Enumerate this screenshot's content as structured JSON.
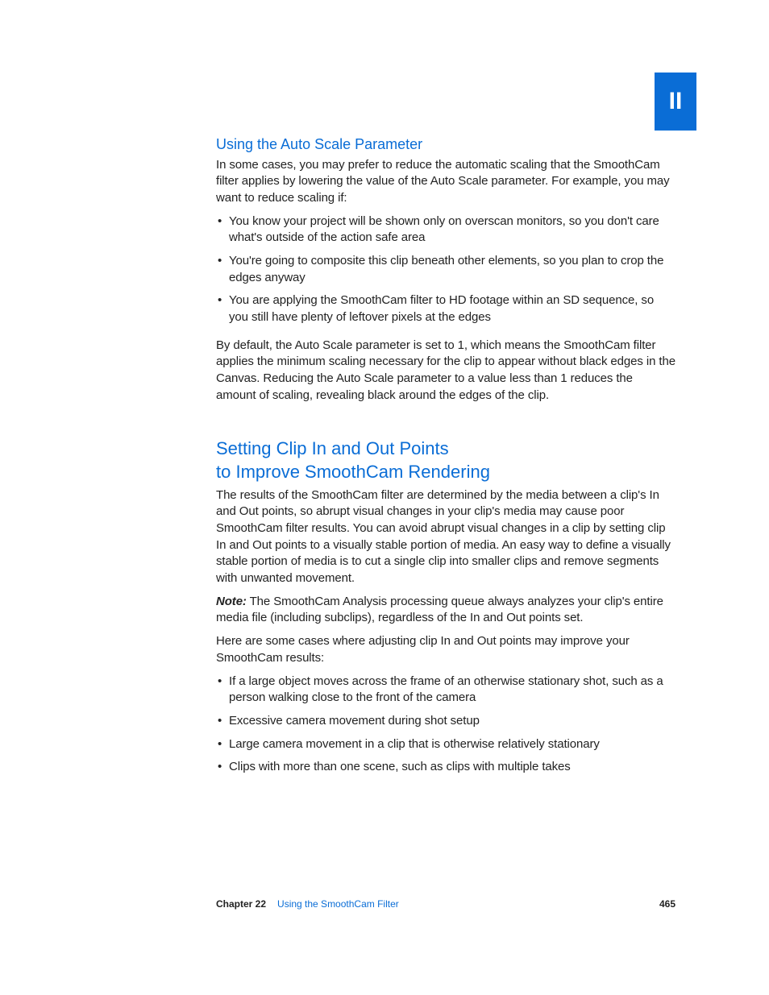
{
  "tab": "II",
  "section1": {
    "heading": "Using the Auto Scale Parameter",
    "intro": "In some cases, you may prefer to reduce the automatic scaling that the SmoothCam filter applies by lowering the value of the Auto Scale parameter. For example, you may want to reduce scaling if:",
    "bullets": [
      "You know your project will be shown only on overscan monitors, so you don't care what's outside of the action safe area",
      "You're going to composite this clip beneath other elements, so you plan to crop the edges anyway",
      "You are applying the SmoothCam filter to HD footage within an SD sequence, so you still have plenty of leftover pixels at the edges"
    ],
    "after": "By default, the Auto Scale parameter is set to 1, which means the SmoothCam filter applies the minimum scaling necessary for the clip to appear without black edges in the Canvas. Reducing the Auto Scale parameter to a value less than 1 reduces the amount of scaling, revealing black around the edges of the clip."
  },
  "section2": {
    "heading_line1": "Setting Clip In and Out Points",
    "heading_line2": "to Improve SmoothCam Rendering",
    "para1": "The results of the SmoothCam filter are determined by the media between a clip's In and Out points, so abrupt visual changes in your clip's media may cause poor SmoothCam filter results. You can avoid abrupt visual changes in a clip by setting clip In and Out points to a visually stable portion of media. An easy way to define a visually stable portion of media is to cut a single clip into smaller clips and remove segments with unwanted movement.",
    "note_label": "Note:",
    "note_body": "  The SmoothCam Analysis processing queue always analyzes your clip's entire media file (including subclips), regardless of the In and Out points set.",
    "para2": "Here are some cases where adjusting clip In and Out points may improve your SmoothCam results:",
    "bullets": [
      "If a large object moves across the frame of an otherwise stationary shot, such as a person walking close to the front of the camera",
      "Excessive camera movement during shot setup",
      "Large camera movement in a clip that is otherwise relatively stationary",
      "Clips with more than one scene, such as clips with multiple takes"
    ]
  },
  "footer": {
    "chapter": "Chapter 22",
    "title": "Using the SmoothCam Filter",
    "page": "465"
  }
}
